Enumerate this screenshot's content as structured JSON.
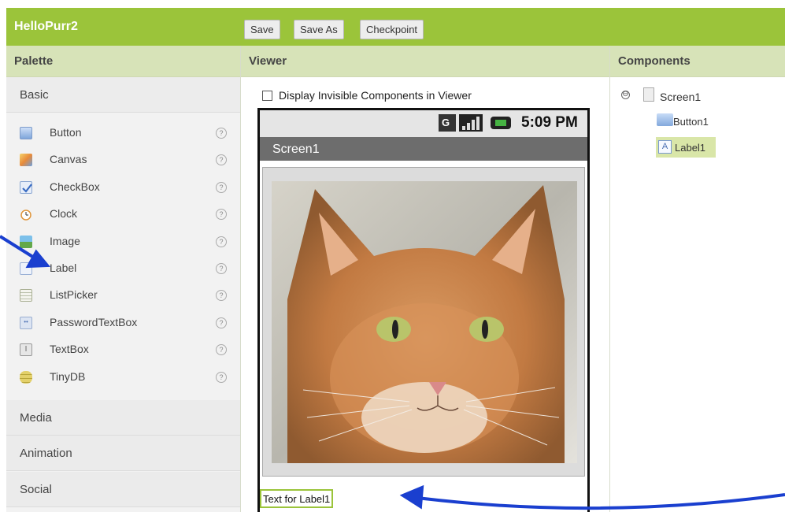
{
  "app": {
    "title": "HelloPurr2"
  },
  "toolbar": {
    "save": "Save",
    "save_as": "Save As",
    "checkpoint": "Checkpoint"
  },
  "palette": {
    "header": "Palette",
    "categories": {
      "basic": "Basic",
      "media": "Media",
      "animation": "Animation",
      "social": "Social"
    },
    "help_glyph": "?",
    "items": [
      {
        "label": "Button",
        "icon": "button-icon",
        "color": "#8fb3e6"
      },
      {
        "label": "Canvas",
        "icon": "canvas-icon",
        "color": "#f0b84a"
      },
      {
        "label": "CheckBox",
        "icon": "checkbox-icon",
        "color": "#5a84c8"
      },
      {
        "label": "Clock",
        "icon": "clock-icon",
        "color": "#e8a050"
      },
      {
        "label": "Image",
        "icon": "image-icon",
        "color": "#5aa7d6"
      },
      {
        "label": "Label",
        "icon": "label-icon",
        "color": "#e9eef6"
      },
      {
        "label": "ListPicker",
        "icon": "listpicker-icon",
        "color": "#d7dad0"
      },
      {
        "label": "PasswordTextBox",
        "icon": "password-textbox-icon",
        "color": "#c8d3e6"
      },
      {
        "label": "TextBox",
        "icon": "textbox-icon",
        "color": "#cfcfcf"
      },
      {
        "label": "TinyDB",
        "icon": "tinydb-icon",
        "color": "#d8c85a"
      }
    ]
  },
  "viewer": {
    "header": "Viewer",
    "display_invisible_label": "Display Invisible Components in Viewer",
    "status_time": "5:09 PM",
    "screen_title": "Screen1",
    "label_text": "Text for Label1"
  },
  "components": {
    "header": "Components",
    "toggle_glyph": "⊖",
    "tree": {
      "screen": "Screen1",
      "button": "Button1",
      "label": "Label1",
      "label_icon_glyph": "A"
    }
  },
  "colors": {
    "brand_green": "#9bc43a",
    "arrow_blue": "#1a3fcf"
  }
}
